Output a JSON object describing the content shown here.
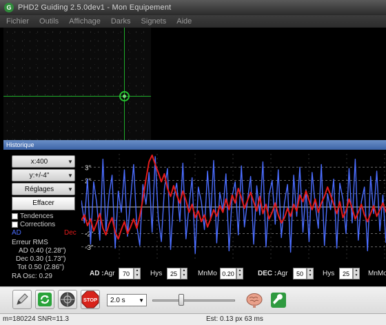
{
  "window": {
    "title": "PHD2 Guiding 2.5.0dev1 - Mon Equipement",
    "app_icon_letter": "G"
  },
  "menu": [
    "Fichier",
    "Outils",
    "Affichage",
    "Darks",
    "Signets",
    "Aide"
  ],
  "history": {
    "header": "Historique",
    "x_scale_label": "x:400",
    "y_scale_label": "y:+/-4\"",
    "settings_label": "Réglages",
    "clear_label": "Effacer",
    "trends_label": "Tendences",
    "corrections_label": "Corrections",
    "legend": {
      "ra": "AD",
      "dec": "Dec",
      "ra_color": "#4b6dff",
      "dec_color": "#e41b1b"
    },
    "stats": {
      "title": "Erreur RMS",
      "ra": "AD 0.40 (2.28\")",
      "dec": "Dec 0.30 (1.73\")",
      "tot": "Tot 0.50 (2.86\")",
      "ra_osc": "RA Osc: 0.29"
    },
    "y_ticks": [
      "3\"",
      "2\"",
      "-2\"",
      "-3\""
    ]
  },
  "chart_data": {
    "type": "line",
    "ylim": [
      -4,
      4
    ],
    "grid": true,
    "series": [
      {
        "name": "AD",
        "color": "#4b6dff",
        "values": [
          0.5,
          -1.2,
          2.1,
          -2.8,
          1.9,
          0.3,
          -2.5,
          3.6,
          -1.8,
          0.9,
          2.4,
          -3.1,
          1.2,
          -0.4,
          2.8,
          -2.2,
          0.6,
          3.2,
          -1.4,
          -2.9,
          1.7,
          0.2,
          2.6,
          -1.9,
          3.8,
          -0.8,
          -2.6,
          1.4,
          2.9,
          -3.2,
          0.7,
          1.8,
          -1.1,
          3.3,
          -2.4,
          0.1,
          2.2,
          -3.5,
          1.5,
          0.4,
          -1.7,
          2.7,
          -0.9,
          3.5,
          -2.7,
          1.1,
          -0.3,
          2.5,
          -3.3,
          0.8,
          1.9,
          -2.1,
          3.1,
          -1.5,
          0.5,
          2.3,
          -2.8,
          1.6,
          -0.6,
          3.4,
          -3.0,
          0.9,
          2.0,
          -1.3,
          2.8,
          -2.3,
          0.3,
          1.7,
          -3.4,
          2.4,
          -0.7,
          3.0,
          -1.9,
          1.3,
          -2.6,
          2.6,
          0.2,
          -1.6,
          3.2,
          -2.9,
          1.0,
          -0.2,
          2.1,
          -3.1,
          1.8,
          0.6,
          -2.0,
          2.9,
          -1.2,
          3.6,
          -2.5,
          0.4,
          1.5,
          -3.3,
          2.3,
          -0.5,
          2.7,
          -1.8,
          0.9,
          -2.7
        ]
      },
      {
        "name": "Dec",
        "color": "#e41b1b",
        "values": [
          -1.0,
          -0.6,
          -1.4,
          -0.9,
          -1.8,
          -1.2,
          -0.5,
          -1.6,
          -2.1,
          -1.3,
          -0.8,
          -1.9,
          -2.4,
          -1.7,
          -1.1,
          -2.0,
          -1.5,
          -0.9,
          -1.6,
          -0.7,
          0.6,
          2.1,
          3.4,
          3.9,
          3.2,
          2.6,
          1.9,
          2.5,
          1.4,
          0.8,
          1.6,
          0.9,
          0.3,
          1.2,
          0.5,
          -0.4,
          0.2,
          -0.8,
          -0.3,
          -1.1,
          -0.6,
          -1.5,
          -0.9,
          -0.2,
          -0.7,
          0.1,
          -0.4,
          0.6,
          -0.2,
          0.9,
          0.3,
          1.4,
          0.7,
          -0.1,
          0.5,
          1.1,
          0.4,
          -0.3,
          0.8,
          -0.5,
          0.2,
          -0.9,
          -0.4,
          0.3,
          -0.6,
          -1.2,
          -0.8,
          -0.1,
          -0.7,
          0.2,
          -0.3,
          0.9,
          0.4,
          1.2,
          0.5,
          -0.2,
          0.6,
          -0.4,
          0.3,
          0.8,
          1.5,
          0.9,
          0.2,
          -0.5,
          0.4,
          -0.8,
          -0.3,
          0.6,
          -0.1,
          -0.9,
          -0.4,
          0.2,
          -0.6,
          -1.1,
          -0.5,
          0.1,
          -0.7,
          -0.2,
          0.3,
          -0.4
        ]
      }
    ]
  },
  "params": {
    "ra_label": "AD :",
    "agr_label": "Agr",
    "hys_label": "Hys",
    "mnmo_label": "MnMo",
    "dec_label": "DEC :",
    "ra_agr": "70",
    "ra_hys": "25",
    "ra_mnmo": "0.20",
    "dec_agr": "50",
    "dec_hys": "25",
    "dec_mnmo_label": "MnMo"
  },
  "toolbar": {
    "exposure": "2.0 s",
    "gamma_fraction": 0.35
  },
  "status": {
    "left": "m=180224 SNR=11.3",
    "mid": "Est: 0.13 px 63 ms"
  },
  "colors": {
    "crosshair": "#1fae2a",
    "history_header": "#4a72b5"
  }
}
